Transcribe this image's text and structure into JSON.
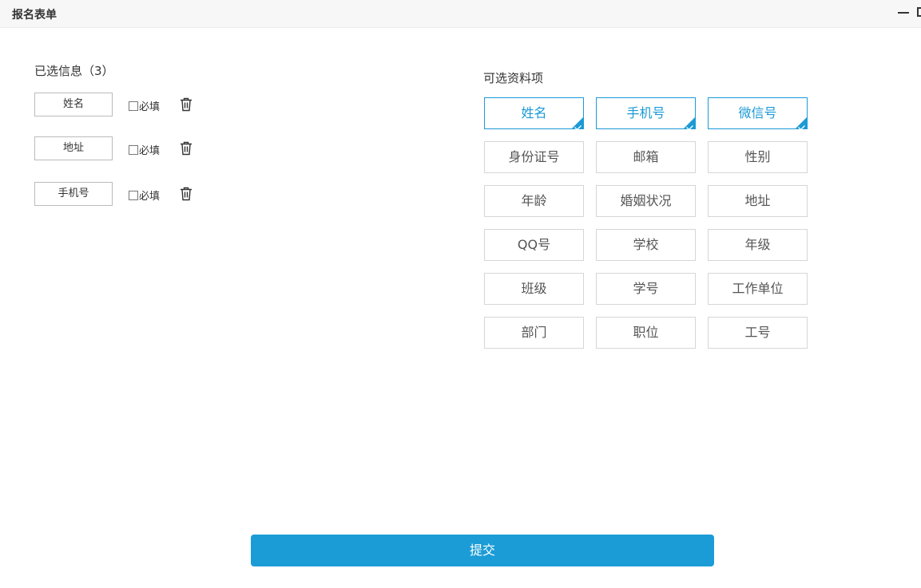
{
  "window": {
    "title": "报名表单",
    "controls": [
      "minimize-icon",
      "maximize-icon"
    ]
  },
  "selected": {
    "heading": "已选信息（3）",
    "items": [
      {
        "label": "姓名",
        "required_label": "必填",
        "required": false
      },
      {
        "label": "地址",
        "required_label": "必填",
        "required": false
      },
      {
        "label": "手机号",
        "required_label": "必填",
        "required": false
      }
    ],
    "delete_icon": "trash-icon"
  },
  "options": {
    "heading": "可选资料项",
    "items": [
      {
        "label": "姓名",
        "selected": true
      },
      {
        "label": "手机号",
        "selected": true
      },
      {
        "label": "微信号",
        "selected": true
      },
      {
        "label": "身份证号",
        "selected": false
      },
      {
        "label": "邮箱",
        "selected": false
      },
      {
        "label": "性别",
        "selected": false
      },
      {
        "label": "年龄",
        "selected": false
      },
      {
        "label": "婚姻状况",
        "selected": false
      },
      {
        "label": "地址",
        "selected": false
      },
      {
        "label": "QQ号",
        "selected": false
      },
      {
        "label": "学校",
        "selected": false
      },
      {
        "label": "年级",
        "selected": false
      },
      {
        "label": "班级",
        "selected": false
      },
      {
        "label": "学号",
        "selected": false
      },
      {
        "label": "工作单位",
        "selected": false
      },
      {
        "label": "部门",
        "selected": false
      },
      {
        "label": "职位",
        "selected": false
      },
      {
        "label": "工号",
        "selected": false
      }
    ]
  },
  "submit_label": "提交",
  "colors": {
    "accent": "#1b9ad6",
    "button": "#1b9cd6",
    "border": "#d6d6d6"
  }
}
